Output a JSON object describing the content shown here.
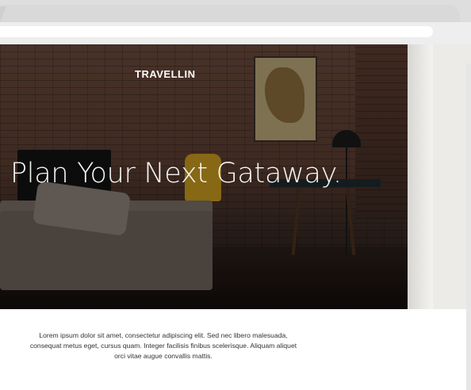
{
  "site": {
    "brand": "TRAVELLIN"
  },
  "hero": {
    "headline": "Plan Your Next Gataway."
  },
  "content": {
    "paragraph": "Lorem ipsum dolor sit amet, consectetur adipiscing elit. Sed nec libero malesuada, consequat metus eget, cursus quam. Integer facilisis finibus scelerisque. Aliquam aliquet orci vitae augue convallis mattis."
  },
  "colors": {
    "text_on_hero": "#ffffff",
    "body_text": "#333333",
    "chrome": "#dedede"
  }
}
